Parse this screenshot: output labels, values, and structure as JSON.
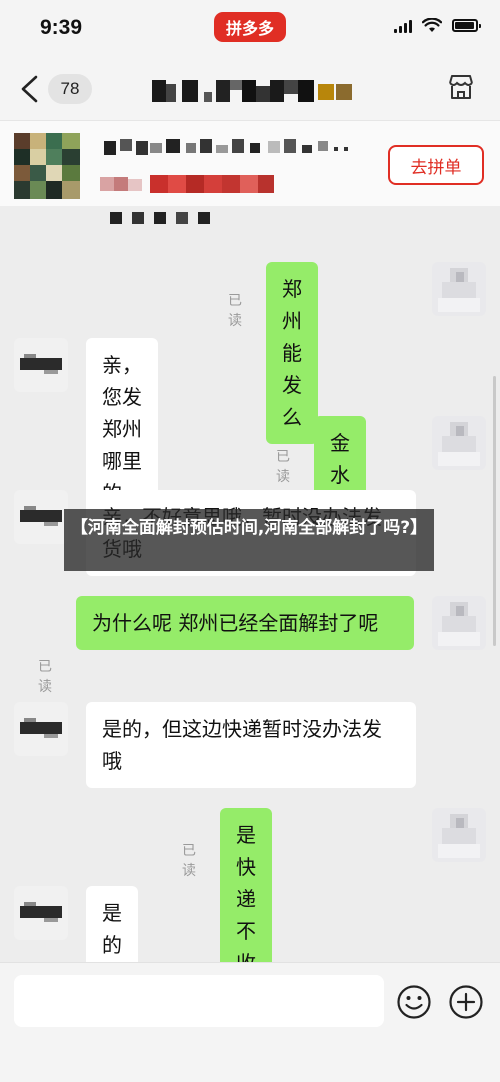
{
  "status_bar": {
    "time": "9:39",
    "app_name": "拼多多",
    "brand_color": "#e02e24"
  },
  "header": {
    "unread_count": "78",
    "back_icon": "chevron-left-icon",
    "store_icon": "store-icon"
  },
  "product_card": {
    "group_buy_label": "去拼单"
  },
  "messages": [
    {
      "side": "sent",
      "text": "郑州能发么",
      "read": "已读"
    },
    {
      "side": "recv",
      "text": "亲，您发郑州哪里的呢?"
    },
    {
      "side": "sent",
      "text": "金水区",
      "read": "已读"
    },
    {
      "side": "recv",
      "text": "亲，不好意思哦，暂时没办法发货哦"
    },
    {
      "side": "sent",
      "text": "为什么呢 郑州已经全面解封了呢",
      "read": "已读"
    },
    {
      "side": "recv",
      "text": "是的，但这边快递暂时没办法发哦"
    },
    {
      "side": "sent",
      "text": "是快递不收货么",
      "read": "已读"
    },
    {
      "side": "recv",
      "text": "是的哦"
    }
  ],
  "banner": {
    "text": "【河南全面解封预估时间,河南全部解封了吗?】"
  },
  "input_bar": {
    "value": "",
    "emoji_icon": "emoji-smile-icon",
    "add_icon": "plus-circle-icon"
  },
  "colors": {
    "sent_bubble": "#95ec69",
    "recv_bubble": "#ffffff",
    "background": "#ededed"
  }
}
